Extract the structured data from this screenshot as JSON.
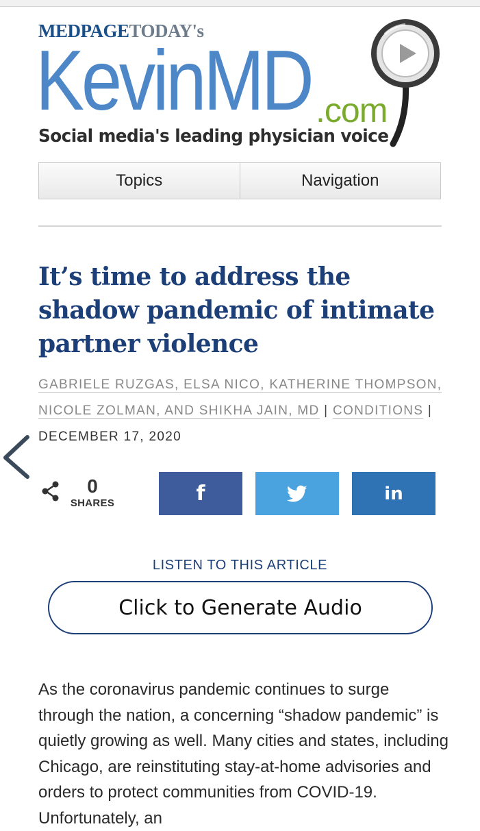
{
  "logo": {
    "medpage_part1": "MEDPAGE",
    "medpage_part2": "TODAY's",
    "kevin": "KevinMD",
    "dotcom": ".com",
    "tagline": "Social media's leading physician voice"
  },
  "menu": {
    "topics": "Topics",
    "navigation": "Navigation"
  },
  "article": {
    "title": "It’s time to address the shadow pandemic of intimate partner violence",
    "authors": "Gabriele Ruzgas, Elsa Nico, Katherine Thompson, Nicole Zolman, and Shikha Jain, MD",
    "category": "Conditions",
    "separator": "|",
    "date": "December 17, 2020",
    "body": "As the coronavirus pandemic continues to surge through the nation, a concerning “shadow pandemic” is quietly growing as well. Many cities and states, including Chicago, are reinstituting stay-at-home advisories and orders to protect communities from COVID-19. Unfortunately, an"
  },
  "share": {
    "count": "0",
    "label": "SHARES",
    "facebook_glyph": "f",
    "linkedin_glyph": "in"
  },
  "audio": {
    "listen_label": "LISTEN TO THIS ARTICLE",
    "button_label": "Click to Generate Audio"
  },
  "colors": {
    "brand_blue": "#4d87c8",
    "title_navy": "#1d3f78",
    "dotcom_green": "#7aaa2e",
    "facebook": "#3e5b9c",
    "twitter": "#4aa3df",
    "linkedin": "#2f73b4"
  },
  "icons": [
    "stethoscope-icon",
    "chevron-left-icon",
    "share-icon",
    "facebook-icon",
    "twitter-icon",
    "linkedin-icon"
  ]
}
